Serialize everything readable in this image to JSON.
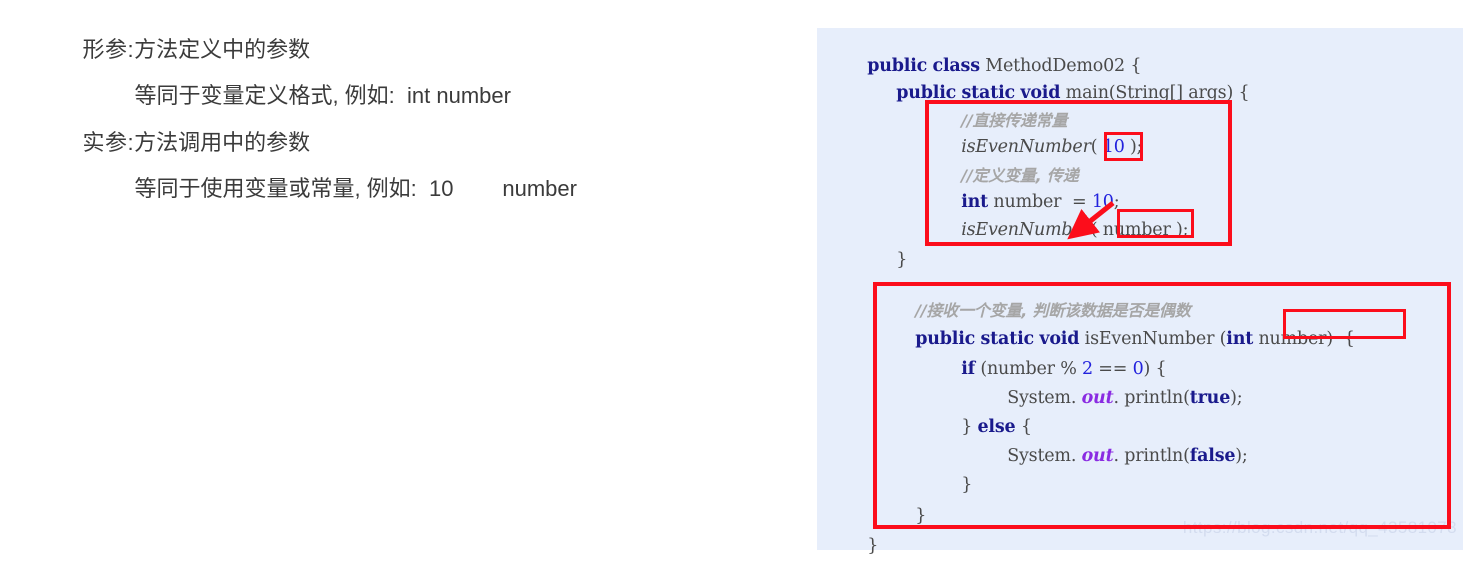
{
  "notes": {
    "lines": [
      {
        "label": "形参:",
        "text": "方法定义中的参数"
      },
      {
        "label": "",
        "text": "等同于变量定义格式, 例如:  int number"
      },
      {
        "label": "实参:",
        "text": "方法调用中的参数"
      },
      {
        "label": "",
        "text": "等同于使用变量或常量, 例如:  10        number"
      }
    ]
  },
  "code": {
    "language": "java",
    "class_name": "MethodDemo02",
    "lines": [
      {
        "indent": 0,
        "text": "public class MethodDemo02 {"
      },
      {
        "indent": 1,
        "text": "public static void main(String[] args) {"
      },
      {
        "indent": 2,
        "text": "//直接传递常量"
      },
      {
        "indent": 2,
        "text": "isEvenNumber( 10 );"
      },
      {
        "indent": 2,
        "text": "//定义变量, 传递"
      },
      {
        "indent": 2,
        "text": "int number  = 10;"
      },
      {
        "indent": 2,
        "text": "isEvenNumber( number );"
      },
      {
        "indent": 1,
        "text": "}"
      },
      {
        "indent": 1,
        "text": "//接收一个变量, 判断该数据是否是偶数"
      },
      {
        "indent": 1,
        "text": "public static void isEvenNumber (int number) {"
      },
      {
        "indent": 2,
        "text": "if (number % 2 == 0) {"
      },
      {
        "indent": 3,
        "text": "System. out. println(true);"
      },
      {
        "indent": 2,
        "text": "} else {"
      },
      {
        "indent": 3,
        "text": "System. out. println(false);"
      },
      {
        "indent": 2,
        "text": "}"
      },
      {
        "indent": 1,
        "text": "}"
      },
      {
        "indent": 0,
        "text": "}"
      }
    ],
    "tokens": {
      "kw_public": "public",
      "kw_class": "class",
      "kw_static": "static",
      "kw_void": "void",
      "kw_int": "int",
      "kw_if": "if",
      "kw_else": "else",
      "kw_true": "true",
      "kw_false": "false",
      "id_main": "main",
      "id_args": "(String[] args) {",
      "id_method": "isEvenNumber",
      "id_number": "number",
      "lit_10": "10",
      "lit_2": "2",
      "lit_0": "0",
      "comment_1": "//直接传递常量",
      "comment_2": "//定义变量, 传递",
      "comment_3": "//接收一个变量, 判断该数据是否是偶数",
      "sysout": "System.",
      "out": "out",
      "println": ". println",
      "brace_open": "{",
      "brace_close": "}"
    }
  },
  "annotations": {
    "boxes": [
      {
        "name": "main-body-box",
        "color": "#fc0d1b"
      },
      {
        "name": "literal-10-box",
        "color": "#fc0d1b"
      },
      {
        "name": "variable-number-box",
        "color": "#fc0d1b"
      },
      {
        "name": "method-definition-box",
        "color": "#fc0d1b"
      },
      {
        "name": "parameter-int-number-box",
        "color": "#fc0d1b"
      }
    ],
    "arrow": {
      "name": "red-arrow",
      "color": "#fc0d1b"
    }
  },
  "watermark": {
    "text": "https://blog.csdn.net/qq_43581078"
  },
  "colors": {
    "code_background": "#e7eefb",
    "keyword": "#1a1a8c",
    "number": "#2222dd",
    "comment": "#a6a6a6",
    "field": "#8a2be2",
    "annotation_red": "#fc0d1b",
    "body_text": "#3b3b3b"
  }
}
